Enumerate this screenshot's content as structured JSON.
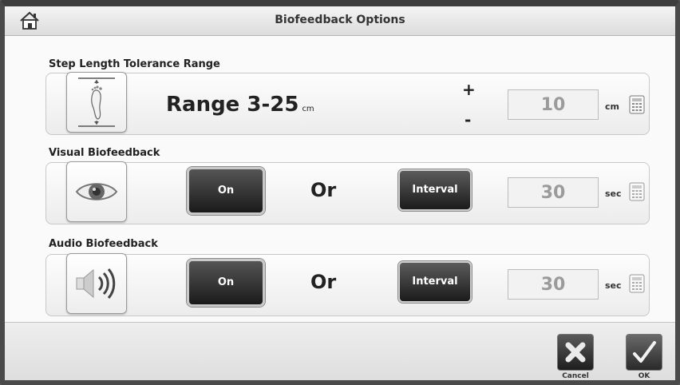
{
  "header": {
    "title": "Biofeedback Options",
    "home_icon": "home-icon"
  },
  "step_length": {
    "label": "Step Length Tolerance Range",
    "range_text": "Range 3-25",
    "range_unit": "cm",
    "plus": "+",
    "minus": "-",
    "value": "10",
    "unit": "cm",
    "icon": "footprint-icon"
  },
  "visual": {
    "label": "Visual Biofeedback",
    "on_label": "On",
    "or_label": "Or",
    "interval_label": "Interval",
    "value": "30",
    "unit": "sec",
    "icon": "eye-icon"
  },
  "audio": {
    "label": "Audio Biofeedback",
    "on_label": "On",
    "or_label": "Or",
    "interval_label": "Interval",
    "value": "30",
    "unit": "sec",
    "icon": "speaker-icon"
  },
  "footer": {
    "cancel_label": "Cancel",
    "ok_label": "OK"
  }
}
